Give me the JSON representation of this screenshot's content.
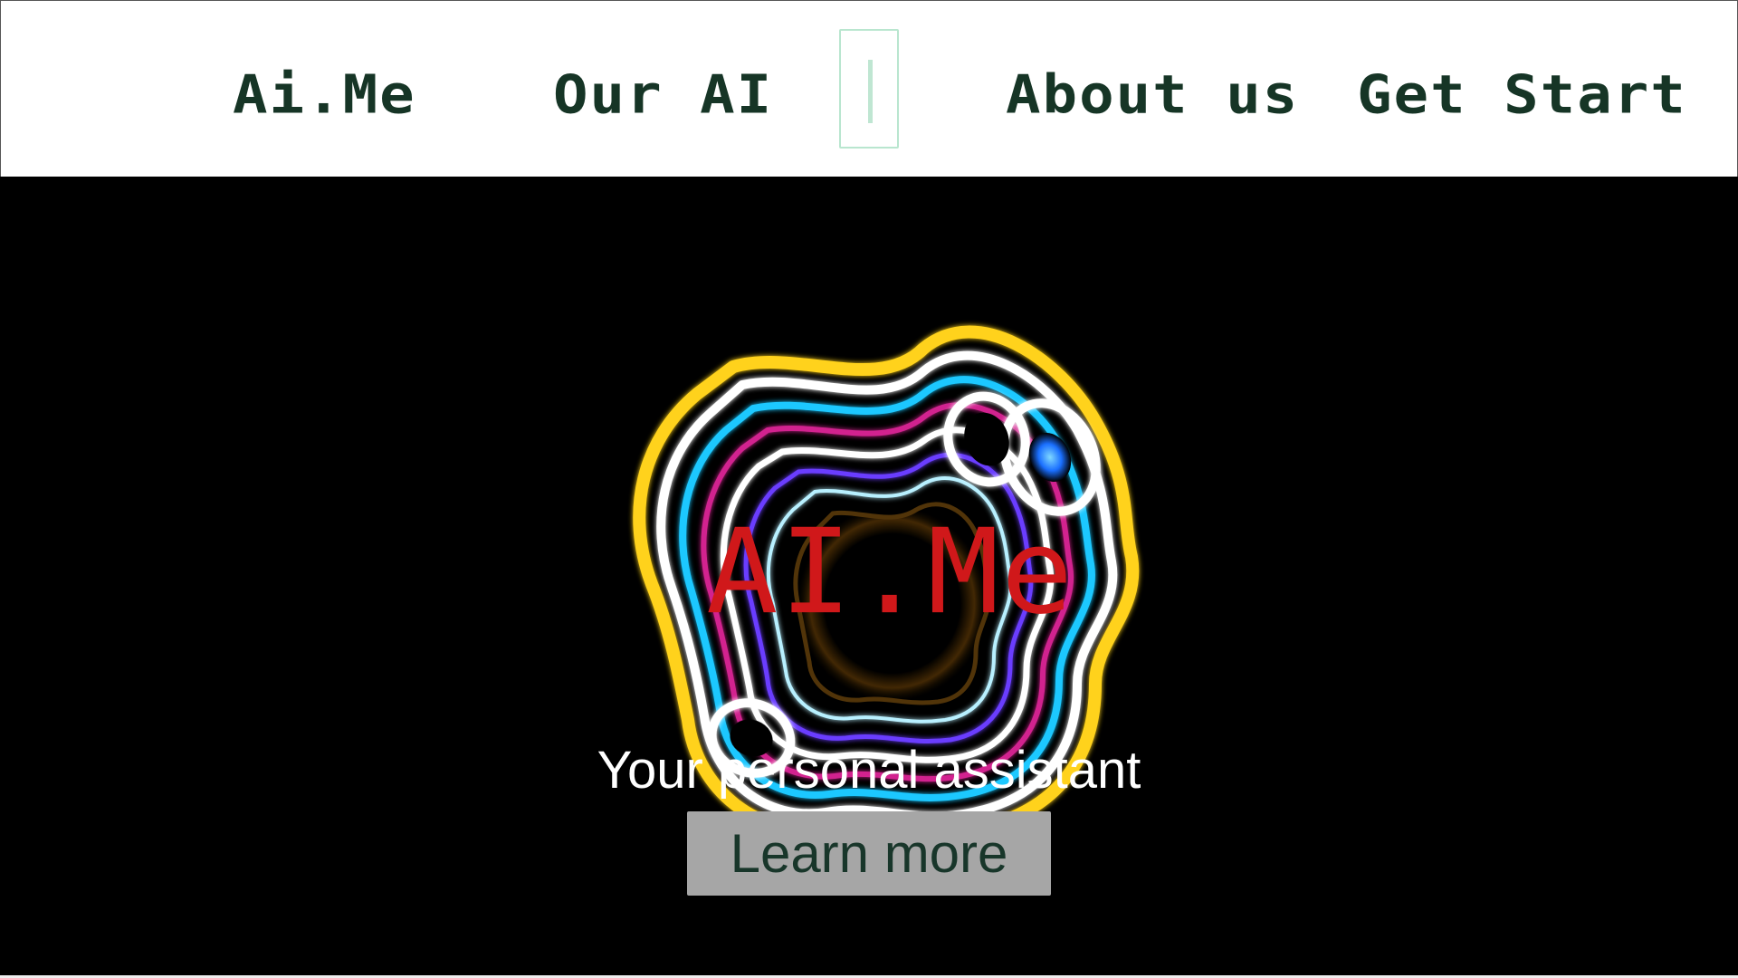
{
  "nav": {
    "brand": "Ai.Me",
    "items": [
      {
        "label": "Our AI"
      },
      {
        "label": "About us"
      },
      {
        "label": "Get Start"
      }
    ]
  },
  "hero": {
    "title": "AI.Me",
    "tagline": "Your personal assistant",
    "button_label": "Learn more",
    "art_icon": "swirl-rings-icon"
  },
  "colors": {
    "nav_text": "#163526",
    "nav_bg": "#ffffff",
    "hero_bg": "#000000",
    "hero_title": "#d0181a",
    "tagline": "#ffffff",
    "button_bg": "#a6a6a6",
    "button_text": "#18362a",
    "accent_box": "#b9e6cf"
  }
}
